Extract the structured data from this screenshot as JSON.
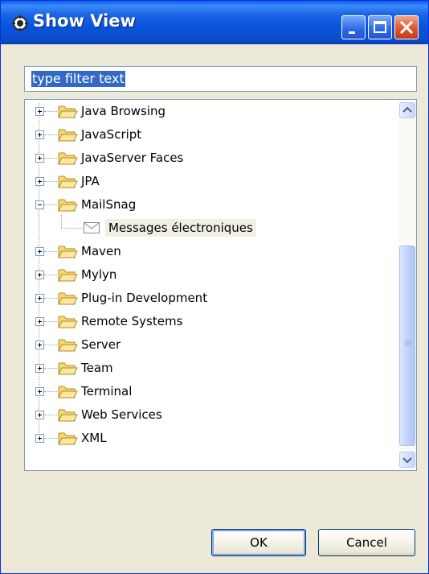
{
  "window": {
    "title": "Show View"
  },
  "filter": {
    "value": "type filter text"
  },
  "tree": {
    "items": [
      {
        "label": "Java Browsing",
        "expanded": false
      },
      {
        "label": "JavaScript",
        "expanded": false
      },
      {
        "label": "JavaServer Faces",
        "expanded": false
      },
      {
        "label": "JPA",
        "expanded": false
      },
      {
        "label": "MailSnag",
        "expanded": true,
        "children": [
          {
            "label": "Messages électroniques",
            "icon": "envelope-icon"
          }
        ]
      },
      {
        "label": "Maven",
        "expanded": false
      },
      {
        "label": "Mylyn",
        "expanded": false
      },
      {
        "label": "Plug-in Development",
        "expanded": false
      },
      {
        "label": "Remote Systems",
        "expanded": false
      },
      {
        "label": "Server",
        "expanded": false
      },
      {
        "label": "Team",
        "expanded": false
      },
      {
        "label": "Terminal",
        "expanded": false
      },
      {
        "label": "Web Services",
        "expanded": false
      },
      {
        "label": "XML",
        "expanded": false
      }
    ]
  },
  "buttons": {
    "ok": "OK",
    "cancel": "Cancel"
  },
  "colors": {
    "titlebar": "#0853d9",
    "selection": "#316ac5",
    "dialog_bg": "#ece9d8",
    "close_button": "#e0552c"
  }
}
